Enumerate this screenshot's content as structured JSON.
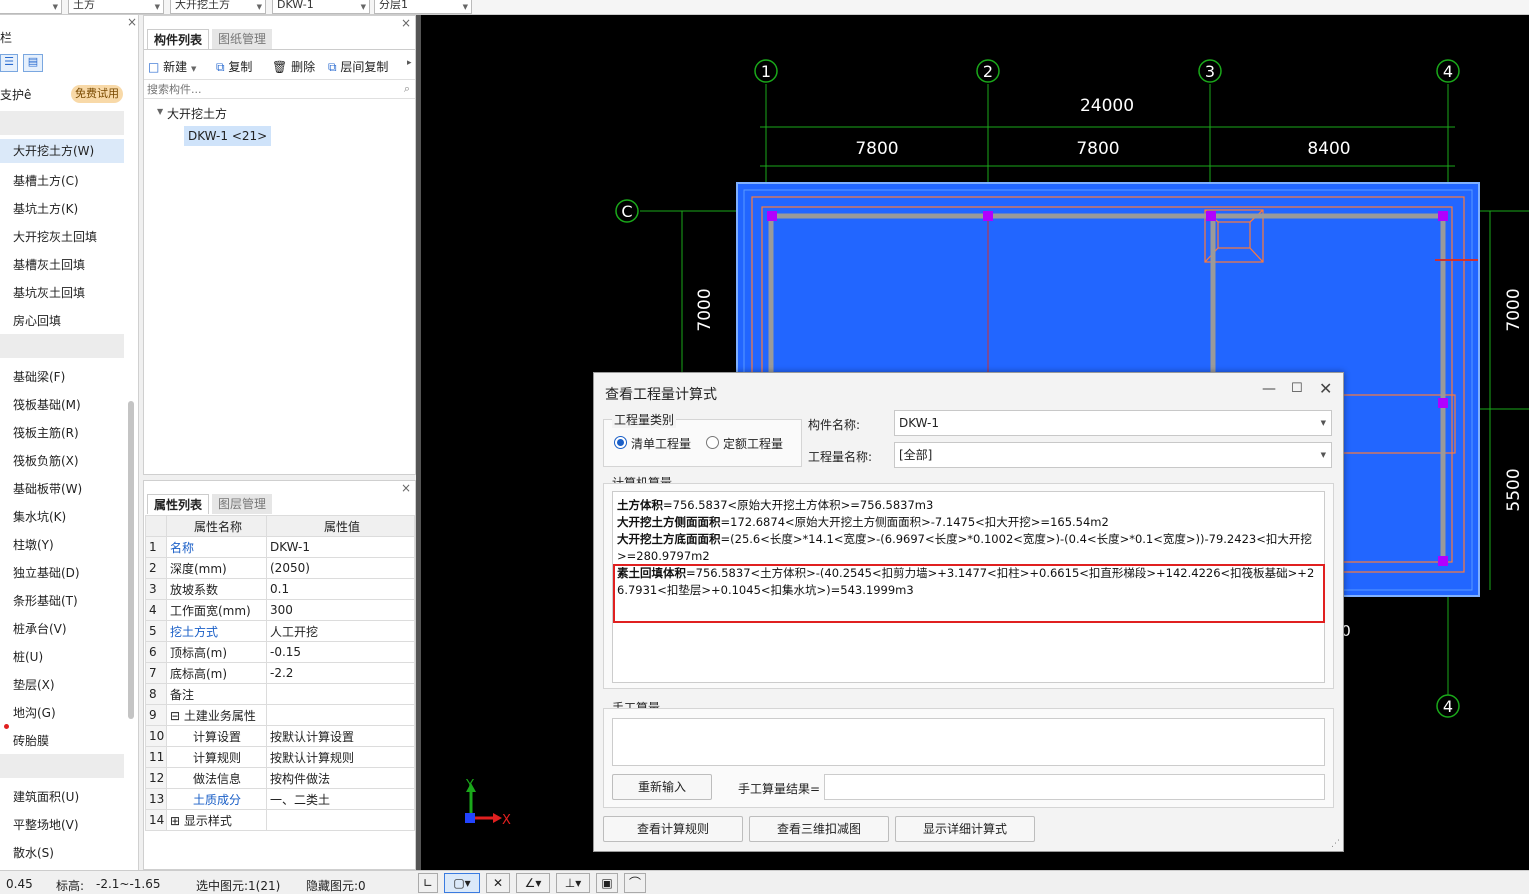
{
  "topbar": {
    "sel1": "土方",
    "sel2": "大开挖土方",
    "sel3": "DKW-1",
    "sel4": "分层1",
    "close": "×"
  },
  "leftnav": {
    "header": "栏",
    "protect": "支护ê",
    "trial": "免费试用",
    "items_a": [
      "大开挖土方(W)",
      "基槽土方(C)",
      "基坑土方(K)",
      "大开挖灰土回填",
      "基槽灰土回填",
      "基坑灰土回填",
      "房心回填"
    ],
    "items_b": [
      "基础梁(F)",
      "筏板基础(M)",
      "筏板主筋(R)",
      "筏板负筋(X)",
      "基础板带(W)",
      "集水坑(K)",
      "柱墩(Y)",
      "独立基础(D)",
      "条形基础(T)",
      "桩承台(V)",
      "桩(U)",
      "垫层(X)",
      "地沟(G)",
      "砖胎膜"
    ],
    "items_c": [
      "建筑面积(U)",
      "平整场地(V)",
      "散水(S)"
    ]
  },
  "comp": {
    "tab1": "构件列表",
    "tab2": "图纸管理",
    "new": "新建",
    "copy": "复制",
    "delete": "删除",
    "floorcopy": "层间复制",
    "search_placeholder": "搜索构件...",
    "tree_parent": "大开挖土方",
    "tree_child": "DKW-1 <21>",
    "close": "×"
  },
  "prop": {
    "tab1": "属性列表",
    "tab2": "图层管理",
    "col_name": "属性名称",
    "col_value": "属性值",
    "rows": [
      {
        "n": "1",
        "name": "名称",
        "value": "DKW-1"
      },
      {
        "n": "2",
        "name": "深度(mm)",
        "value": "(2050)"
      },
      {
        "n": "3",
        "name": "放坡系数",
        "value": "0.1"
      },
      {
        "n": "4",
        "name": "工作面宽(mm)",
        "value": "300"
      },
      {
        "n": "5",
        "name": "挖土方式",
        "value": "人工开挖"
      },
      {
        "n": "6",
        "name": "顶标高(m)",
        "value": "-0.15"
      },
      {
        "n": "7",
        "name": "底标高(m)",
        "value": "-2.2"
      },
      {
        "n": "8",
        "name": "备注",
        "value": ""
      },
      {
        "n": "9",
        "name": "土建业务属性",
        "value": ""
      },
      {
        "n": "10",
        "name": "计算设置",
        "value": "按默认计算设置"
      },
      {
        "n": "11",
        "name": "计算规则",
        "value": "按默认计算规则"
      },
      {
        "n": "12",
        "name": "做法信息",
        "value": "按构件做法"
      },
      {
        "n": "13",
        "name": "土质成分",
        "value": "一、二类土"
      },
      {
        "n": "14",
        "name": "显示样式",
        "value": ""
      }
    ],
    "close": "×"
  },
  "canvas": {
    "axes": [
      "1",
      "2",
      "3",
      "4"
    ],
    "axis_c": "C",
    "total_dim": "24000",
    "dims": [
      "7800",
      "7800",
      "8400"
    ],
    "left_dim": "7000",
    "right_dim1": "7000",
    "right_dim2": "5500",
    "axis_bottom": "4",
    "y_label": "Y",
    "x_label": "X",
    "partial_right": "0"
  },
  "dialog": {
    "title": "查看工程量计算式",
    "qty_type": "工程量类别",
    "radio1": "清单工程量",
    "radio2": "定额工程量",
    "comp_name_label": "构件名称:",
    "comp_name_value": "DKW-1",
    "qty_name_label": "工程量名称:",
    "qty_name_value": "[全部]",
    "computer_section": "计算机算量",
    "formulas": [
      {
        "bold": "土方体积",
        "text": "=756.5837<原始大开挖土方体积>=756.5837m3"
      },
      {
        "bold": "大开挖土方侧面面积",
        "text": "=172.6874<原始大开挖土方侧面面积>-7.1475<扣大开挖>=165.54m2"
      },
      {
        "bold": "大开挖土方底面面积",
        "text": "=(25.6<长度>*14.1<宽度>-(6.9697<长度>*0.1002<宽度>)-(0.4<长度>*0.1<宽度>))-79.2423<扣大开挖>=280.9797m2"
      },
      {
        "bold": "素土回填体积",
        "text": "=756.5837<土方体积>-(40.2545<扣剪力墙>+3.1477<扣柱>+0.6615<扣直形梯段>+142.4226<扣筏板基础>+26.7931<扣垫层>+0.1045<扣集水坑>)=543.1999m3"
      }
    ],
    "manual_section": "手工算量",
    "reinput": "重新输入",
    "manual_result": "手工算量结果=",
    "btn_rules": "查看计算规则",
    "btn_3d": "查看三维扣减图",
    "btn_detail": "显示详细计算式"
  },
  "status": {
    "coord": "0.45",
    "elev_label": "标高:",
    "elev_value": "-2.1~-1.65",
    "selected": "选中图元:1(21)",
    "hidden": "隐藏图元:0"
  },
  "colors": {
    "canvas_bg": "#000000",
    "pit_blue": "#2266ff",
    "axis_green": "#1aa81a",
    "highlight_red": "#e02020",
    "link_blue": "#1a5fc7"
  }
}
